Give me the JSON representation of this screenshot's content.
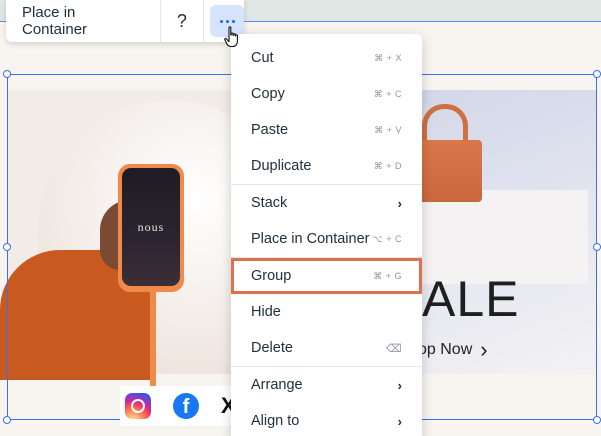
{
  "toolbar": {
    "place_label": "Place in Container",
    "help_label": "?"
  },
  "menu": {
    "items": [
      {
        "label": "Cut",
        "shortcut": "⌘ + X"
      },
      {
        "label": "Copy",
        "shortcut": "⌘ + C"
      },
      {
        "label": "Paste",
        "shortcut": "⌘ + V"
      },
      {
        "label": "Duplicate",
        "shortcut": "⌘ + D"
      },
      {
        "label": "Stack",
        "submenu": "›"
      },
      {
        "label": "Place in Container",
        "shortcut": "⌥ + C"
      },
      {
        "label": "Group",
        "shortcut": "⌘ + G"
      },
      {
        "label": "Hide"
      },
      {
        "label": "Delete",
        "shortcut": "⌫"
      },
      {
        "label": "Arrange",
        "submenu": "›"
      },
      {
        "label": "Align to",
        "submenu": "›"
      }
    ]
  },
  "hero": {
    "sale_text": "ALE",
    "shop_text": "op Now",
    "shop_arrow": "›",
    "phone_brand": "nous"
  },
  "social": {
    "x_glyph": "X",
    "fb_glyph": "f"
  },
  "colors": {
    "accent": "#116dff",
    "selection": "#3b6ff0",
    "highlight": "#e0704f"
  }
}
